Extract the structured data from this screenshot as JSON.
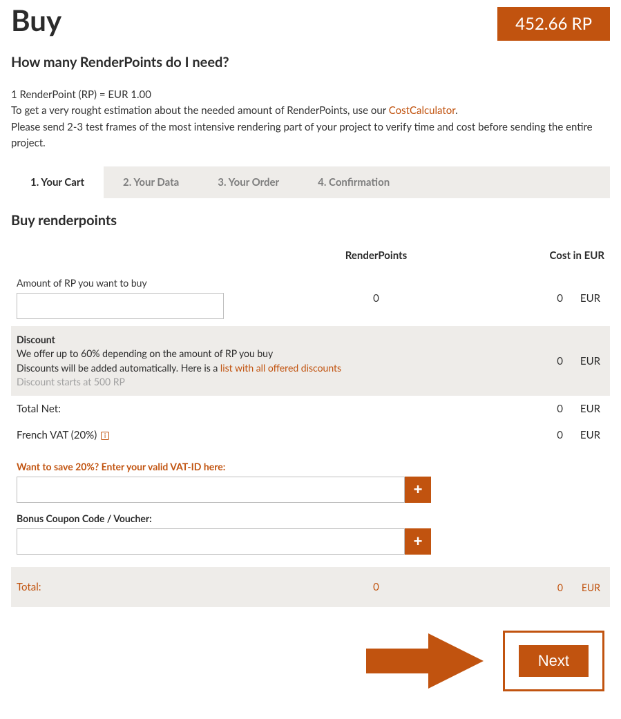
{
  "accent": "#c1530f",
  "header": {
    "title": "Buy",
    "rp_badge": "452.66 RP"
  },
  "intro": {
    "subtitle": "How many RenderPoints do I need?",
    "line1": "1 RenderPoint (RP) = EUR 1.00",
    "line2a": "To get a very rought estimation about the needed amount of RenderPoints, use our ",
    "cost_calc_link": "CostCalculator",
    "line2c": ".",
    "line3": "Please send 2-3 test frames of the most intensive rendering part of your project to verify time and cost before sending the entire project."
  },
  "tabs": [
    {
      "label": "1. Your Cart",
      "active": true
    },
    {
      "label": "2. Your Data",
      "active": false
    },
    {
      "label": "3. Your Order",
      "active": false
    },
    {
      "label": "4. Confirmation",
      "active": false
    }
  ],
  "section_title": "Buy renderpoints",
  "table_head": {
    "col_left": "",
    "col_rp": "RenderPoints",
    "col_cost": "Cost in EUR"
  },
  "amount": {
    "label": "Amount of RP you want to buy",
    "value": "",
    "rp": "0",
    "cost": "0",
    "cur": "EUR"
  },
  "discount": {
    "title": "Discount",
    "line1": "We offer up to 60% depending on the amount of RP you buy",
    "line2a": "Discounts will be added automatically. Here is a ",
    "list_link": "list with all offered discounts",
    "line3_muted": "Discount starts at 500 RP",
    "cost": "0",
    "cur": "EUR"
  },
  "net": {
    "label": "Total Net:",
    "cost": "0",
    "cur": "EUR"
  },
  "vat": {
    "label": "French VAT (20%)",
    "cost": "0",
    "cur": "EUR"
  },
  "vat_input": {
    "label": "Want to save 20%? Enter your valid VAT-ID here:",
    "value": ""
  },
  "coupon": {
    "label": "Bonus Coupon Code / Voucher:",
    "value": ""
  },
  "total": {
    "label": "Total:",
    "rp": "0",
    "cost": "0",
    "cur": "EUR"
  },
  "next_label": "Next"
}
